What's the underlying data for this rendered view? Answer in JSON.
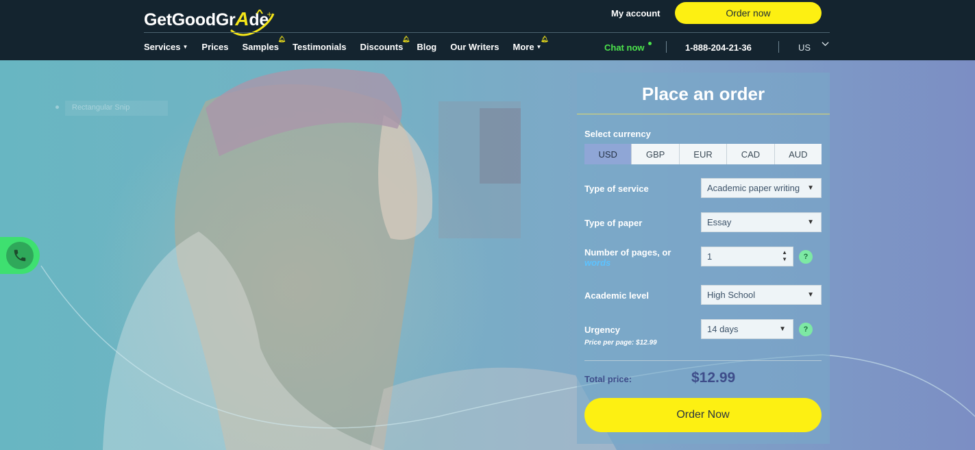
{
  "header": {
    "logo_prefix": "GetGoodGr",
    "logo_a": "A",
    "logo_suffix": "de",
    "my_account": "My account",
    "order_now": "Order now",
    "nav": [
      {
        "label": "Services",
        "caret": true
      },
      {
        "label": "Prices"
      },
      {
        "label": "Samples",
        "badge": "bell-icon"
      },
      {
        "label": "Testimonials"
      },
      {
        "label": "Discounts",
        "badge": "bell-icon"
      },
      {
        "label": "Blog"
      },
      {
        "label": "Our Writers"
      },
      {
        "label": "More",
        "caret": true,
        "badge": "bell-icon"
      }
    ],
    "chat_now": "Chat now",
    "phone": "1-888-204-21-36",
    "region": "US"
  },
  "hero": {
    "snip_label": "Rectangular Snip"
  },
  "order_form": {
    "title": "Place an order",
    "currency_label": "Select currency",
    "currencies": [
      "USD",
      "GBP",
      "EUR",
      "CAD",
      "AUD"
    ],
    "selected_currency": "USD",
    "service_label": "Type of service",
    "service_value": "Academic paper writing",
    "paper_label": "Type of paper",
    "paper_value": "Essay",
    "pages_label": "Number of pages, or",
    "pages_words_link": "words",
    "pages_value": "1",
    "level_label": "Academic level",
    "level_value": "High School",
    "urgency_label": "Urgency",
    "urgency_value": "14 days",
    "price_per_page": "Price per page:  $12.99",
    "total_label": "Total price:",
    "total_value": "$12.99",
    "order_button": "Order Now",
    "help_symbol": "?"
  },
  "colors": {
    "header_bg": "#14242f",
    "accent_yellow": "#fdf012",
    "chat_green": "#4ce34c",
    "total_text": "#3e4d8a",
    "active_currency": "#8fa6d6"
  }
}
